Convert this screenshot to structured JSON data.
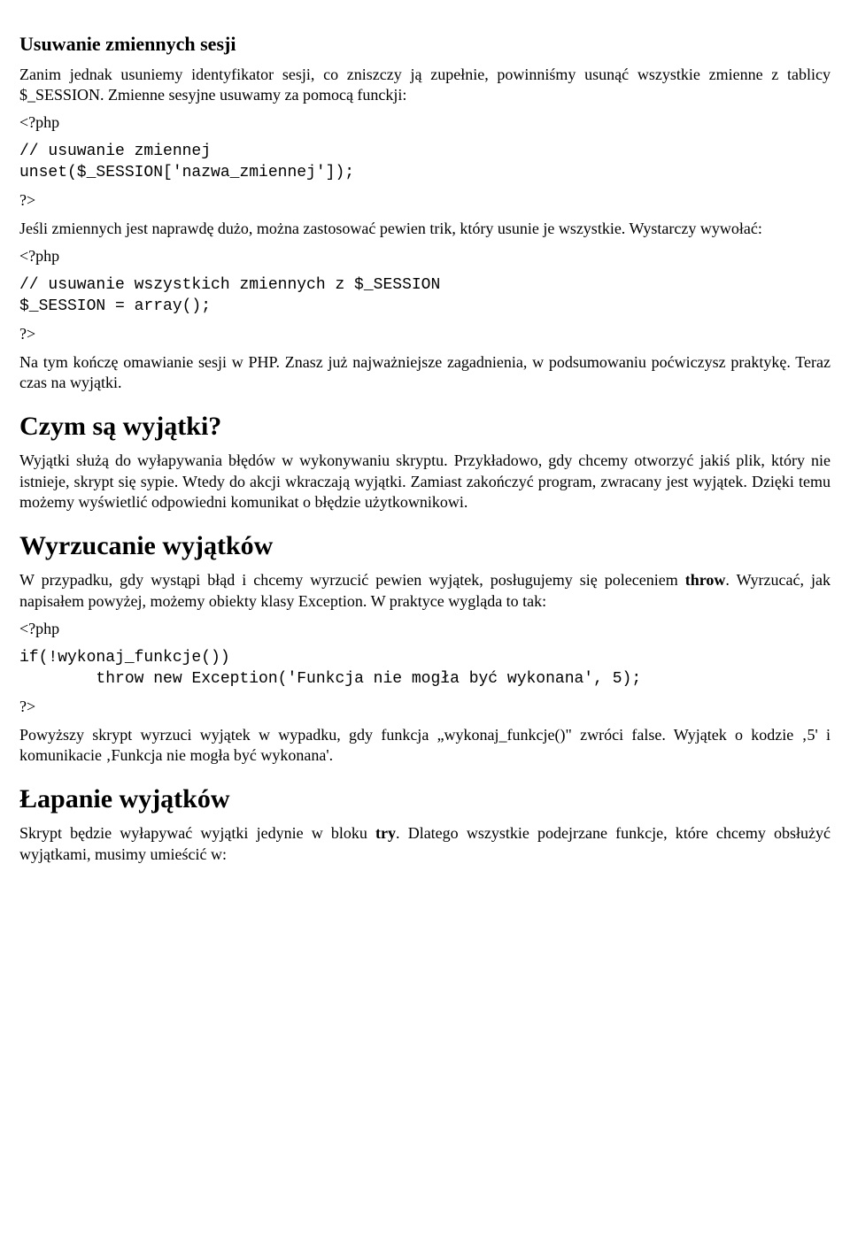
{
  "h1_1": "Usuwanie zmiennych sesji",
  "p1": "Zanim jednak usuniemy identyfikator sesji, co zniszczy ją zupełnie, powinniśmy usunąć wszystkie zmienne z tablicy $_SESSION. Zmienne sesyjne usuwamy za pomocą funckji:",
  "phpopen": "<?php",
  "code1": "// usuwanie zmiennej\nunset($_SESSION['nazwa_zmiennej']);",
  "phpclose": "?>",
  "p2": "Jeśli zmiennych jest naprawdę dużo, można zastosować pewien trik, który usunie je wszystkie. Wystarczy wywołać:",
  "code2": "// usuwanie wszystkich zmiennych z $_SESSION\n$_SESSION = array();",
  "p3": "Na tym kończę omawianie sesji w PHP. Znasz już najważniejsze zagadnienia, w podsumowaniu poćwiczysz praktykę. Teraz czas na wyjątki.",
  "h1_2": "Czym są wyjątki?",
  "p4": "Wyjątki służą do wyłapywania błędów w wykonywaniu skryptu. Przykładowo, gdy chcemy otworzyć jakiś plik, który nie istnieje, skrypt się sypie. Wtedy do akcji wkraczają wyjątki. Zamiast zakończyć program, zwracany jest wyjątek. Dzięki temu możemy wyświetlić odpowiedni komunikat o błędzie użytkownikowi.",
  "h1_3": "Wyrzucanie wyjątków",
  "p5a": "W przypadku, gdy wystąpi błąd i chcemy wyrzucić pewien wyjątek, posługujemy się poleceniem ",
  "p5b": "throw",
  "p5c": ". Wyrzucać, jak napisałem powyżej, możemy obiekty klasy Exception. W praktyce wygląda to tak:",
  "code3": "if(!wykonaj_funkcje())\n        throw new Exception('Funkcja nie mogła być wykonana', 5);",
  "p6": "Powyższy skrypt wyrzuci wyjątek w wypadku, gdy funkcja „wykonaj_funkcje()\" zwróci false. Wyjątek o kodzie ‚5' i komunikacie ‚Funkcja nie mogła być wykonana'.",
  "h1_4": "Łapanie wyjątków",
  "p7a": "Skrypt będzie wyłapywać wyjątki jedynie w bloku ",
  "p7b": "try",
  "p7c": ". Dlatego wszystkie podejrzane funkcje, które chcemy obsłużyć wyjątkami, musimy umieścić w:"
}
